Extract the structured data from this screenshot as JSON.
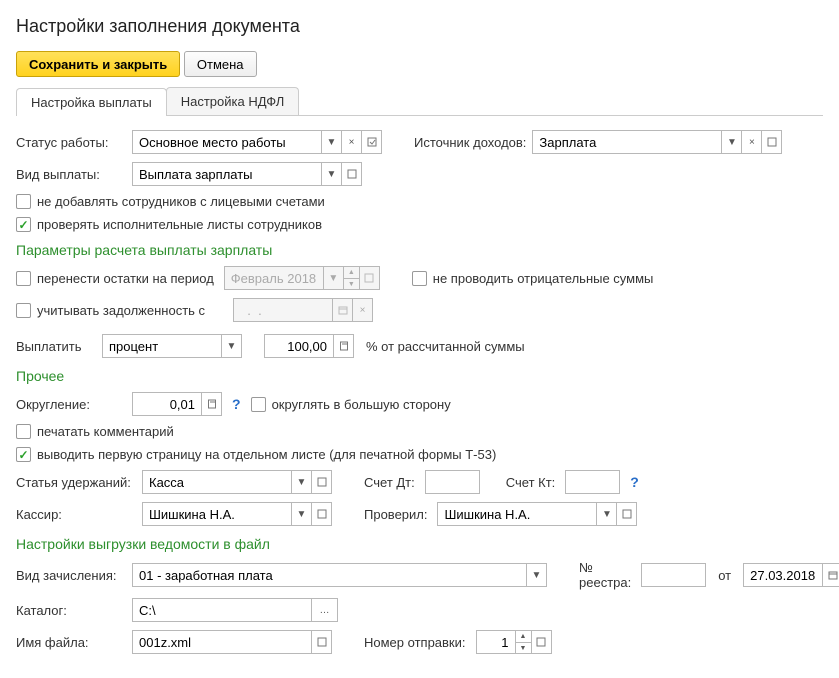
{
  "title": "Настройки заполнения документа",
  "buttons": {
    "save_close": "Сохранить и закрыть",
    "cancel": "Отмена"
  },
  "tabs": {
    "payout": "Настройка выплаты",
    "ndfl": "Настройка НДФЛ"
  },
  "labels": {
    "work_status": "Статус работы:",
    "income_source": "Источник доходов:",
    "payout_type": "Вид выплаты:",
    "pay": "Выплатить",
    "percent_of": "% от рассчитанной суммы",
    "rounding": "Округление:",
    "deduction_article": "Статья удержаний:",
    "debit_account": "Счет Дт:",
    "credit_account": "Счет Кт:",
    "cashier": "Кассир:",
    "checked_by": "Проверил:",
    "accrual_type": "Вид зачисления:",
    "registry_no": "№ реестра:",
    "from": "от",
    "catalog": "Каталог:",
    "filename": "Имя файла:",
    "send_number": "Номер отправки:"
  },
  "values": {
    "work_status": "Основное место работы",
    "income_source": "Зарплата",
    "payout_type": "Выплата зарплаты",
    "carry_period": "Февраль 2018",
    "debt_from_date": "  .  .    ",
    "pay_mode": "процент",
    "pay_percent": "100,00",
    "rounding": "0,01",
    "deduction_article": "Касса",
    "debit_account": "",
    "credit_account": "",
    "cashier": "Шишкина Н.А.",
    "checked_by": "Шишкина Н.А.",
    "accrual_type": "01 - заработная плата",
    "registry_no": "",
    "registry_date": "27.03.2018",
    "catalog": "C:\\",
    "filename": "001z.xml",
    "send_number": "1"
  },
  "checkboxes": {
    "no_add_employees": {
      "label": "не добавлять сотрудников с лицевыми счетами",
      "checked": false
    },
    "check_exec_sheets": {
      "label": "проверять исполнительные листы сотрудников",
      "checked": true
    },
    "carry_balances": {
      "label": "перенести остатки на период",
      "checked": false
    },
    "no_negative": {
      "label": "не проводить отрицательные суммы",
      "checked": false
    },
    "account_debt": {
      "label": "учитывать задолженность с",
      "checked": false
    },
    "round_up": {
      "label": "округлять в большую сторону",
      "checked": false
    },
    "print_comment": {
      "label": "печатать комментарий",
      "checked": false
    },
    "first_page_sep": {
      "label": "выводить первую страницу на отдельном листе (для печатной формы Т-53)",
      "checked": true
    }
  },
  "sections": {
    "calc": "Параметры расчета выплаты зарплаты",
    "other": "Прочее",
    "export": "Настройки выгрузки ведомости в файл"
  }
}
